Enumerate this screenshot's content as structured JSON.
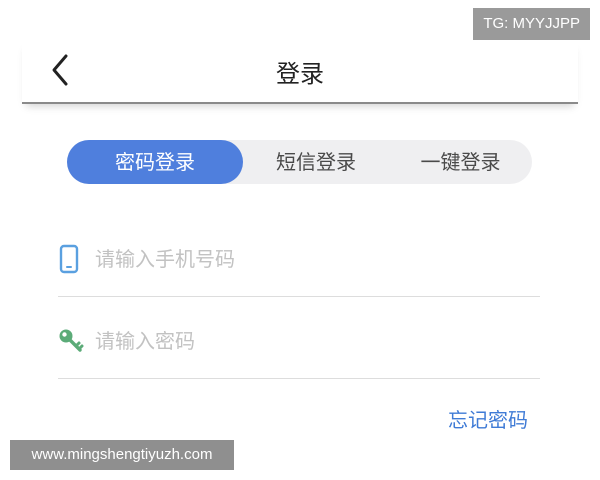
{
  "watermark": {
    "top_text": "TG: MYYJJPP",
    "bottom_text": "www.mingshengtiyuzh.com"
  },
  "header": {
    "title": "登录",
    "back_icon": "chevron-left-icon"
  },
  "tabs": [
    {
      "label": "密码登录",
      "active": true
    },
    {
      "label": "短信登录",
      "active": false
    },
    {
      "label": "一键登录",
      "active": false
    }
  ],
  "form": {
    "phone": {
      "icon": "phone-icon",
      "placeholder": "请输入手机号码",
      "value": ""
    },
    "password": {
      "icon": "key-icon",
      "placeholder": "请输入密码",
      "value": ""
    }
  },
  "forgot_password_label": "忘记密码",
  "colors": {
    "accent": "#4f7fdd",
    "link": "#3f7bd6",
    "tab_background": "#efeff1",
    "phone_icon": "#5aa0e0",
    "key_icon": "#5bab78"
  }
}
